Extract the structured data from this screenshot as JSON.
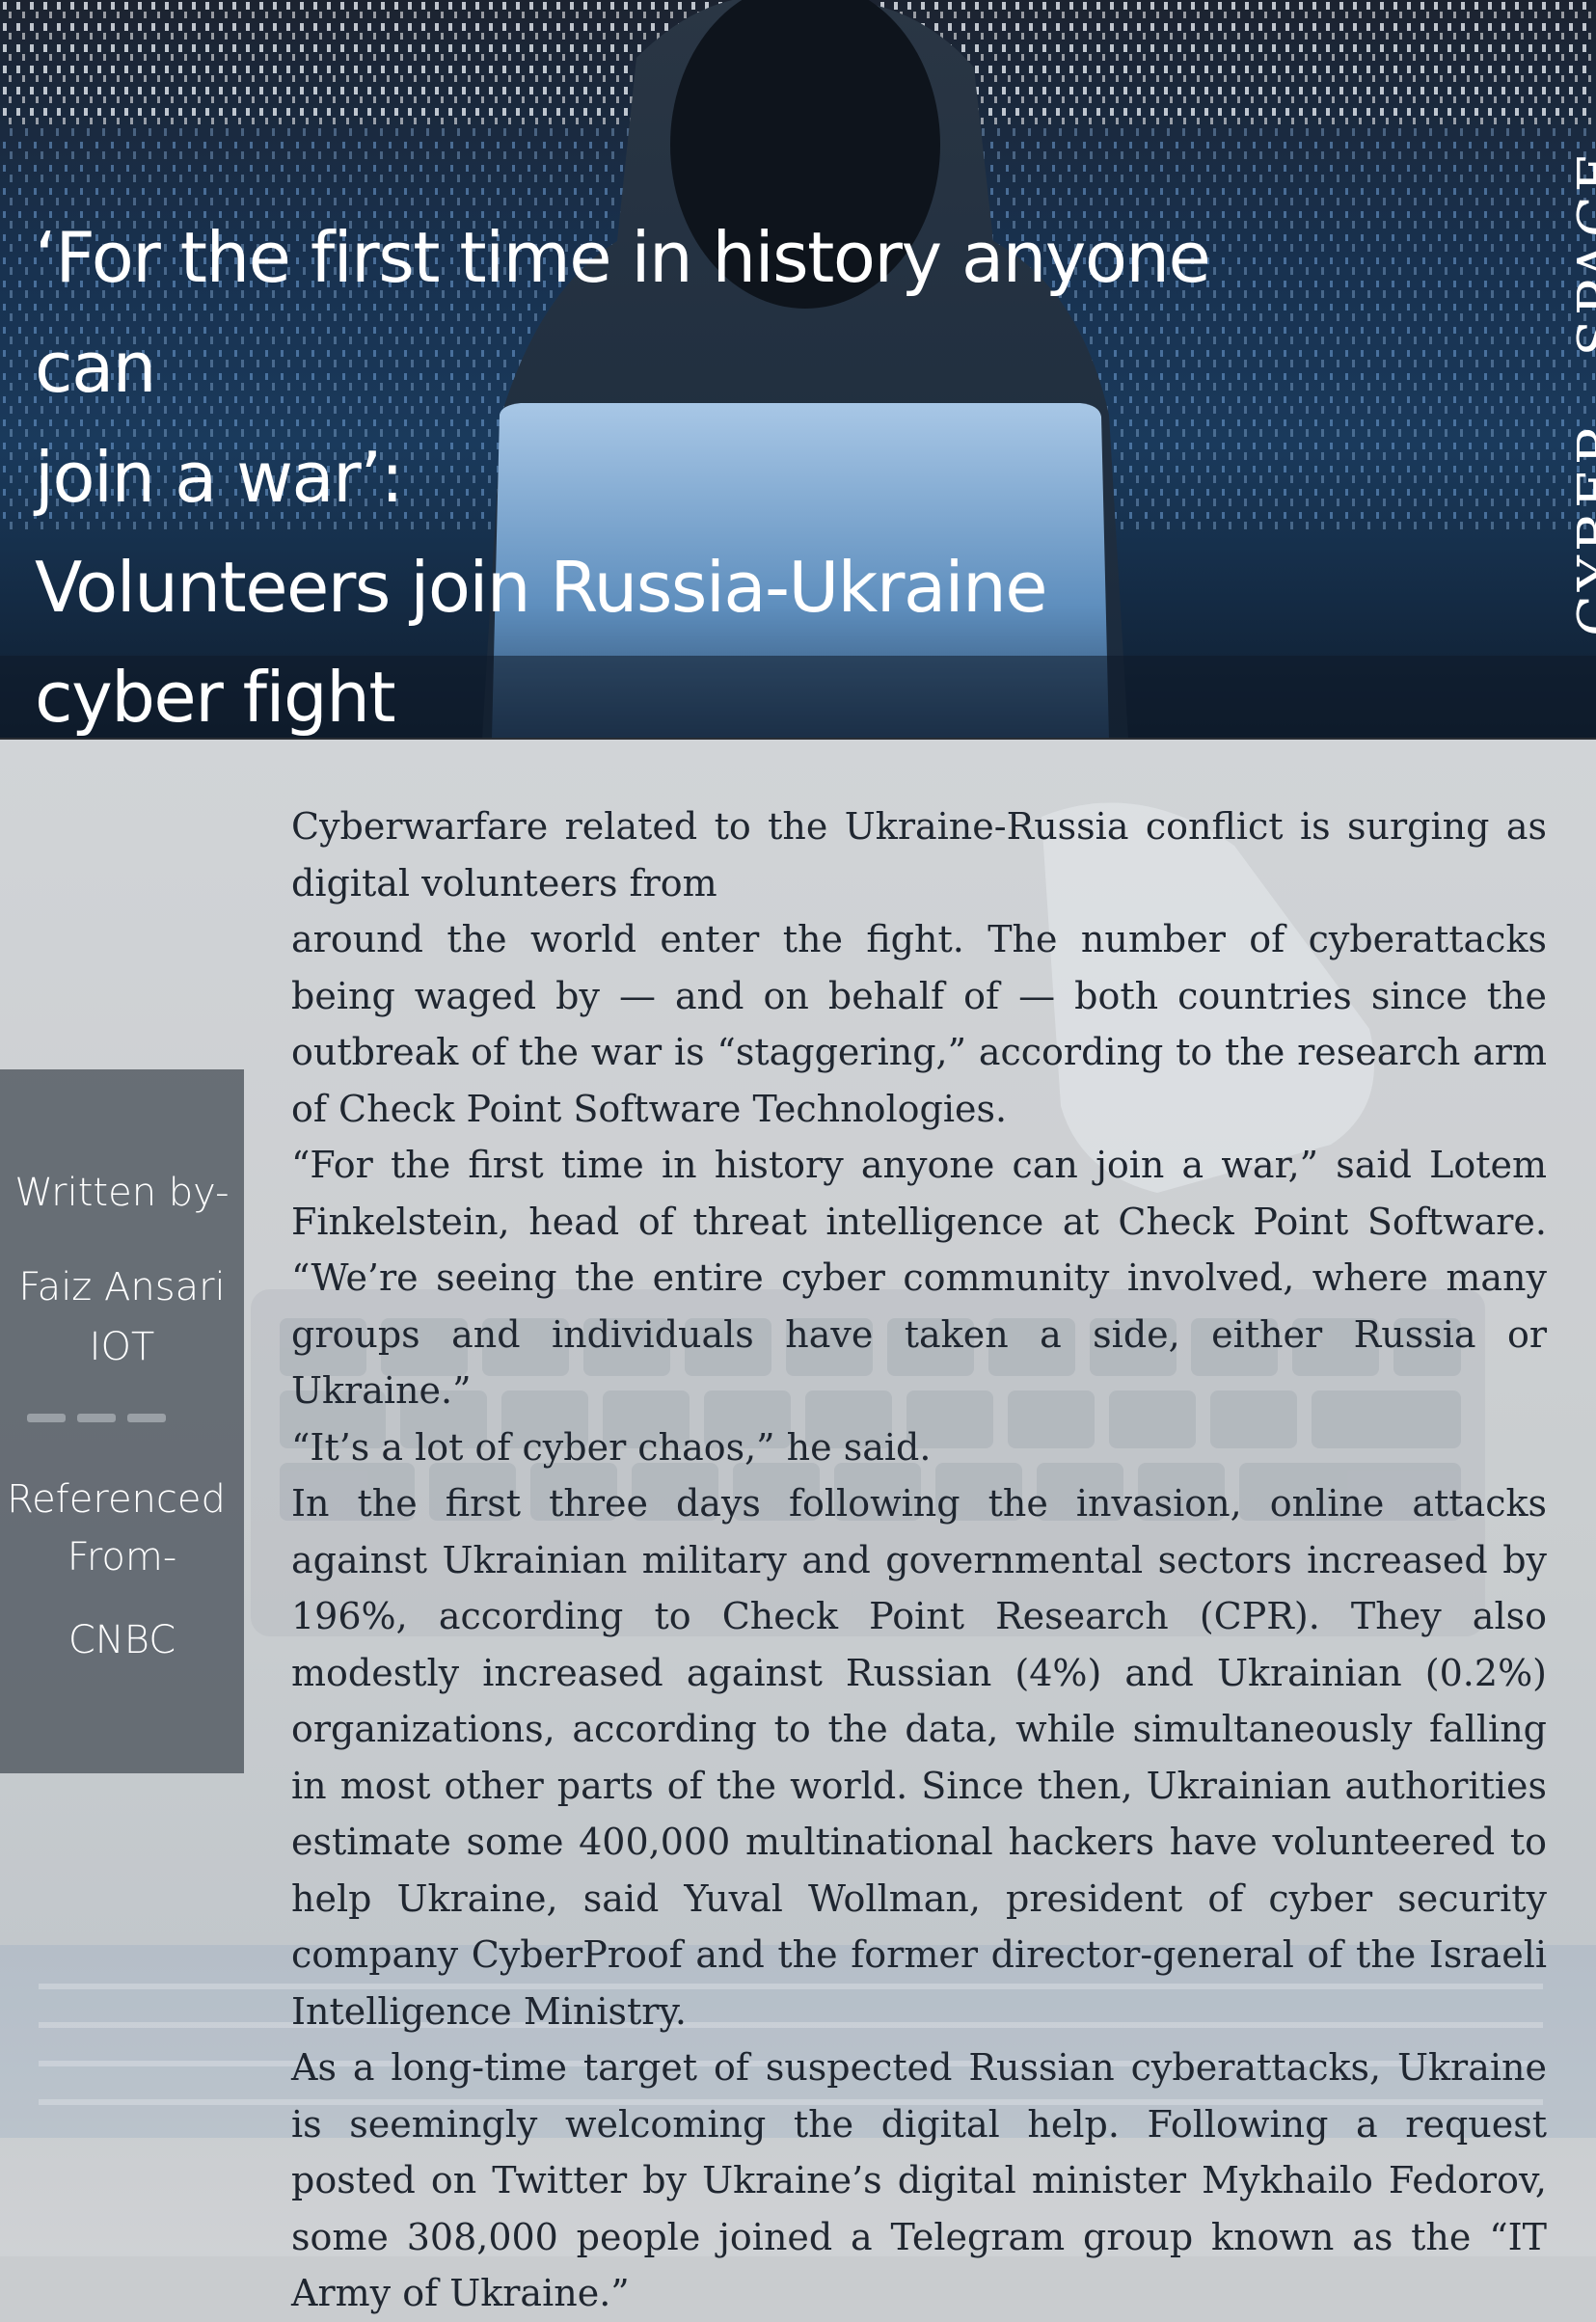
{
  "header": {
    "headline_lines": [
      "‘For the first time in history anyone can",
      "join a war’:",
      "Volunteers join Russia-Ukraine",
      "cyber fight"
    ],
    "side_label": "CYBER - SPACE"
  },
  "sidebar": {
    "written_by": "Written by-",
    "author": "Faiz Ansari",
    "department": "IOT",
    "referenced": "Referenced",
    "from": "From-",
    "source": "CNBC"
  },
  "article": {
    "paragraphs": [
      "Cyberwarfare related to the Ukraine-Russia conflict is surging as digital volunteers from",
      "around the world enter the fight. The number of cyberattacks being waged by — and on behalf of — both countries since the outbreak of the war is “staggering,” according to the research arm of Check Point Software Technologies.",
      "“For the first time in history anyone can join a war,” said Lotem Finkelstein, head of threat intelligence at Check Point Software. “We’re seeing the entire cyber community involved, where many groups and individuals have taken a side, either Russia or Ukraine.”",
      "“It’s a lot of cyber chaos,” he said.",
      "In the first three days following the invasion, online attacks against Ukrainian military and governmental sectors increased by 196%, according to Check Point Research (CPR). They also modestly increased against Russian (4%) and Ukrainian (0.2%) organizations, according to the data, while simultaneously falling in most other parts of the world. Since then, Ukrainian authorities estimate some 400,000 multinational hackers have volunteered to help Ukraine, said Yuval Wollman, president of cyber security company CyberProof and the former director-general of the Israeli Intelligence Ministry.",
      "As a long-time target of suspected Russian cyberattacks, Ukraine is seemingly welcoming the digital help. Following a request posted on Twitter by Ukraine’s digital minister Mykhailo Fedorov, some 308,000 people joined a Telegram group known as the “IT Army of Ukraine.”"
    ]
  },
  "colors": {
    "hero_blue": "#1a3a5c",
    "sidebar_panel": "#505860",
    "body_text": "#1f2630"
  }
}
